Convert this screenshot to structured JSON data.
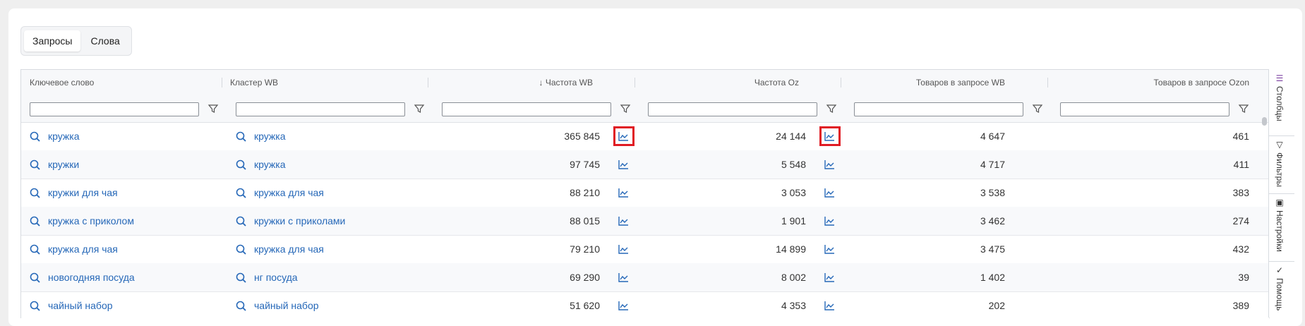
{
  "tabs": [
    "Запросы",
    "Слова"
  ],
  "columns": [
    "Ключевое слово",
    "Кластер WB",
    "↓ Частота WB",
    "Частота Oz",
    "Товаров в запросе WB",
    "Товаров в запросе Ozon"
  ],
  "rows": [
    {
      "keyword": "кружка",
      "cluster": "кружка",
      "freq_wb": "365 845",
      "freq_oz": "24 144",
      "goods_wb": "4 647",
      "goods_oz": "461"
    },
    {
      "keyword": "кружки",
      "cluster": "кружка",
      "freq_wb": "97 745",
      "freq_oz": "5 548",
      "goods_wb": "4 717",
      "goods_oz": "411"
    },
    {
      "keyword": "кружки для чая",
      "cluster": "кружка для чая",
      "freq_wb": "88 210",
      "freq_oz": "3 053",
      "goods_wb": "3 538",
      "goods_oz": "383"
    },
    {
      "keyword": "кружка с приколом",
      "cluster": "кружки с приколами",
      "freq_wb": "88 015",
      "freq_oz": "1 901",
      "goods_wb": "3 462",
      "goods_oz": "274"
    },
    {
      "keyword": "кружка для чая",
      "cluster": "кружка для чая",
      "freq_wb": "79 210",
      "freq_oz": "14 899",
      "goods_wb": "3 475",
      "goods_oz": "432"
    },
    {
      "keyword": "новогодняя посуда",
      "cluster": "нг посуда",
      "freq_wb": "69 290",
      "freq_oz": "8 002",
      "goods_wb": "1 402",
      "goods_oz": "39"
    },
    {
      "keyword": "чайный набор",
      "cluster": "чайный набор",
      "freq_wb": "51 620",
      "freq_oz": "4 353",
      "goods_wb": "202",
      "goods_oz": "389"
    }
  ],
  "side_tabs": [
    "Столбцы",
    "Фильтры",
    "Настройки",
    "Помощь"
  ],
  "colors": {
    "link": "#2668b8",
    "highlight": "#e01b24",
    "accent": "#7b3fa0"
  }
}
